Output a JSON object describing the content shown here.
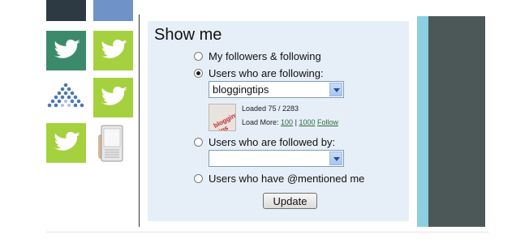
{
  "panel": {
    "title": "Show me",
    "options": [
      "My followers & following",
      "Users who are following:",
      "Users who are followed by:",
      "Users who have @mentioned me"
    ],
    "selected_option": "Users who are following:",
    "following_select_value": "bloggingtips",
    "followed_by_select_value": "",
    "thumbnail": {
      "text": "blogging tips"
    },
    "loaded_text": "Loaded 75 / 2283",
    "load_more_label": "Load More:",
    "load_more_100": "100",
    "separator": "|",
    "load_more_1000": "1000",
    "follow_link": "Follow",
    "update_button": "Update"
  },
  "avatars": [
    "twitter-bird",
    "twitter-bird",
    "blue-dots-logo",
    "twitter-bird",
    "twitter-bird",
    "e-reader"
  ],
  "colors": {
    "panel_bg": "#e6eff8",
    "link_green": "#2f6b3b",
    "teal_bird": "#3b8a6c",
    "green_bird": "#a5d13f",
    "strip": "#8ccfe0",
    "dark_panel": "#4c5858"
  }
}
